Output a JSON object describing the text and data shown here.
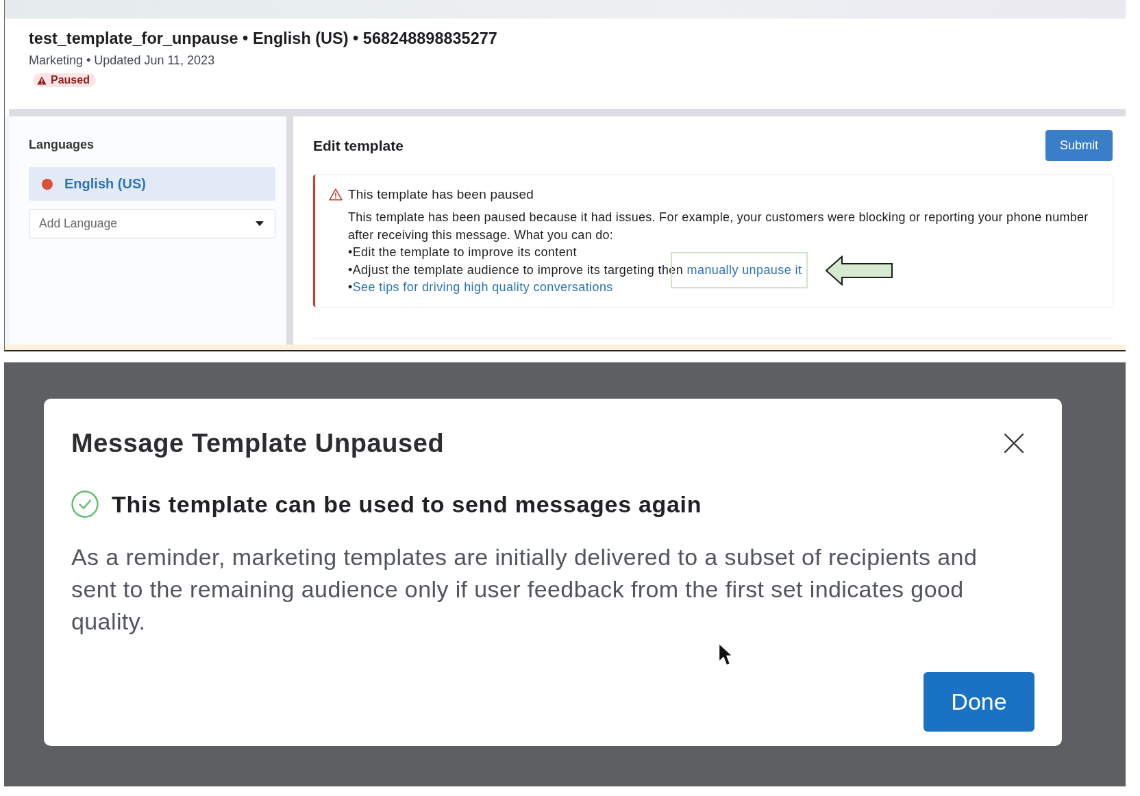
{
  "header": {
    "title": "test_template_for_unpause • English (US) • 568248898835277",
    "subtitle": "Marketing • Updated Jun 11, 2023",
    "status": {
      "label": "Paused",
      "kind": "warning"
    }
  },
  "languages": {
    "heading": "Languages",
    "items": [
      {
        "label": "English (US)",
        "selected": true,
        "color": "#d9503e"
      }
    ],
    "add_language": {
      "placeholder": "Add Language"
    }
  },
  "editor": {
    "heading": "Edit template",
    "submit_button": "Submit",
    "alert": {
      "kind": "error",
      "title": "This template has been paused",
      "body": "This template has been paused because it had issues. For example, your customers were blocking or reporting your phone number after receiving this message. What you can do:",
      "items": [
        {
          "text": "•Edit the template to improve its content"
        },
        {
          "text": "•Adjust the template audience to improve its targeting then ",
          "link": "manually unpause it"
        },
        {
          "text": "•",
          "link": "See tips for driving high quality conversations"
        }
      ]
    }
  },
  "dialog": {
    "title": "Message Template Unpaused",
    "status": {
      "kind": "success",
      "message": "This template can be used to send messages again"
    },
    "body": "As a reminder, marketing templates are initially delivered to a subset of recipients and sent to the remaining audience only if user feedback from the first set indicates good quality.",
    "buttons": [
      {
        "label": "Done",
        "kind": "primary"
      }
    ]
  }
}
